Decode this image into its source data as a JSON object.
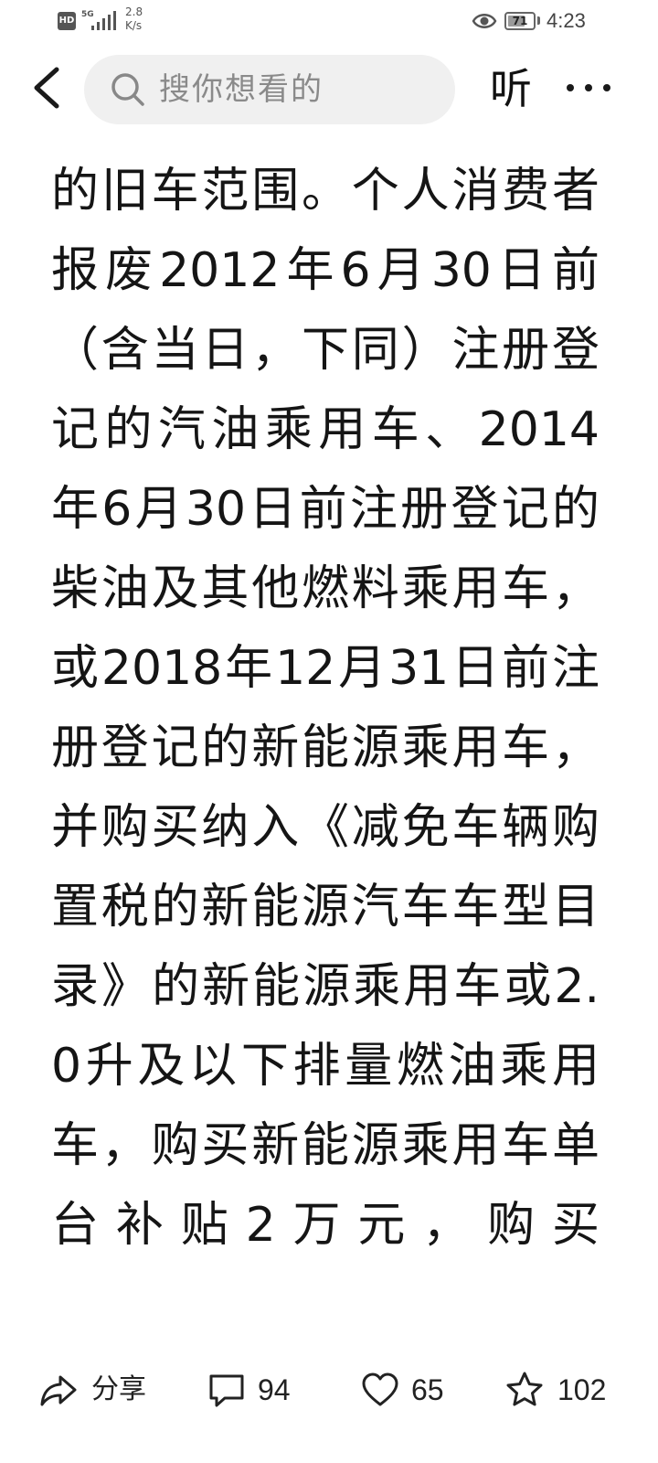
{
  "status_bar": {
    "hd_label": "HD",
    "network_label": "5G",
    "speed_value": "2.8",
    "speed_unit": "K/s",
    "battery_level": "71",
    "battery_fraction": 0.71,
    "time": "4:23"
  },
  "top_bar": {
    "search_placeholder": "搜你想看的",
    "listen_label": "听",
    "icons": [
      "back-arrow-icon",
      "search-icon",
      "more-icon"
    ]
  },
  "article": {
    "body": "纳入可申请报废更新补贴的旧车范围。个人消费者报废2012年6月30日前（含当日，下同）注册登记的汽油乘用车、2014年6月30日前注册登记的柴油及其他燃料乘用车，或2018年12月31日前注册登记的新能源乘用车，并购买纳入《减免车辆购置税的新能源汽车车型目录》的新能源乘用车或2.0升及以下排量燃油乘用车，购买新能源乘用车单台补贴2万元，购买"
  },
  "bottom_bar": {
    "share_label": "分享",
    "comment_count": "94",
    "like_count": "65",
    "favorite_count": "102",
    "icons": [
      "share-icon",
      "comment-icon",
      "heart-icon",
      "star-icon"
    ]
  }
}
